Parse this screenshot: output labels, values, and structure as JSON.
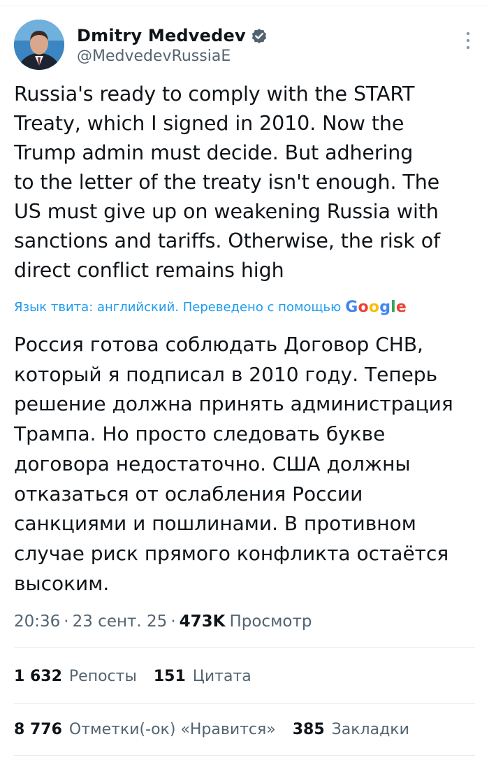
{
  "author": {
    "name": "Dmitry Medvedev",
    "handle": "@MedvedevRussiaE",
    "verified": true,
    "verified_color": "#1d9bf0"
  },
  "tweet": {
    "text_lines": [
      "Russia's ready to comply with the START",
      "Treaty, which I signed in 2010. Now the",
      "Trump admin must decide. But adhering",
      "to the letter of the treaty isn't enough. The",
      "US must give up on weakening Russia with",
      "sanctions and tariffs. Otherwise, the risk of",
      "direct conflict remains high"
    ],
    "translation_note": "Язык твита: английский. Переведено с помощью",
    "translation_provider": "Google",
    "translated_lines": [
      "Россия готова соблюдать Договор СНВ,",
      "который я подписал в 2010 году. Теперь",
      "решение должна принять администрация",
      "Трампа. Но просто следовать букве",
      "договора недостаточно. США должны",
      "отказаться от ослабления России",
      "санкциями и пошлинами. В противном",
      "случае риск прямого конфликта остаётся",
      "высоким."
    ],
    "time": "20:36",
    "date": "23 сент. 25",
    "separator": "·",
    "views_count": "473K",
    "views_label": "Просмотр"
  },
  "stats": {
    "reposts_value": "1 632",
    "reposts_label": "Репосты",
    "quotes_value": "151",
    "quotes_label": "Цитата",
    "likes_value": "8 776",
    "likes_label": "Отметки(-ок) «Нравится»",
    "bookmarks_value": "385",
    "bookmarks_label": "Закладки"
  },
  "colors": {
    "link": "#1d9bf0",
    "secondary_text": "#536471",
    "primary_text": "#0f1419",
    "google_blue": "#4285F4",
    "google_red": "#EA4335",
    "google_yellow": "#FBBC05",
    "google_green": "#34A853"
  }
}
